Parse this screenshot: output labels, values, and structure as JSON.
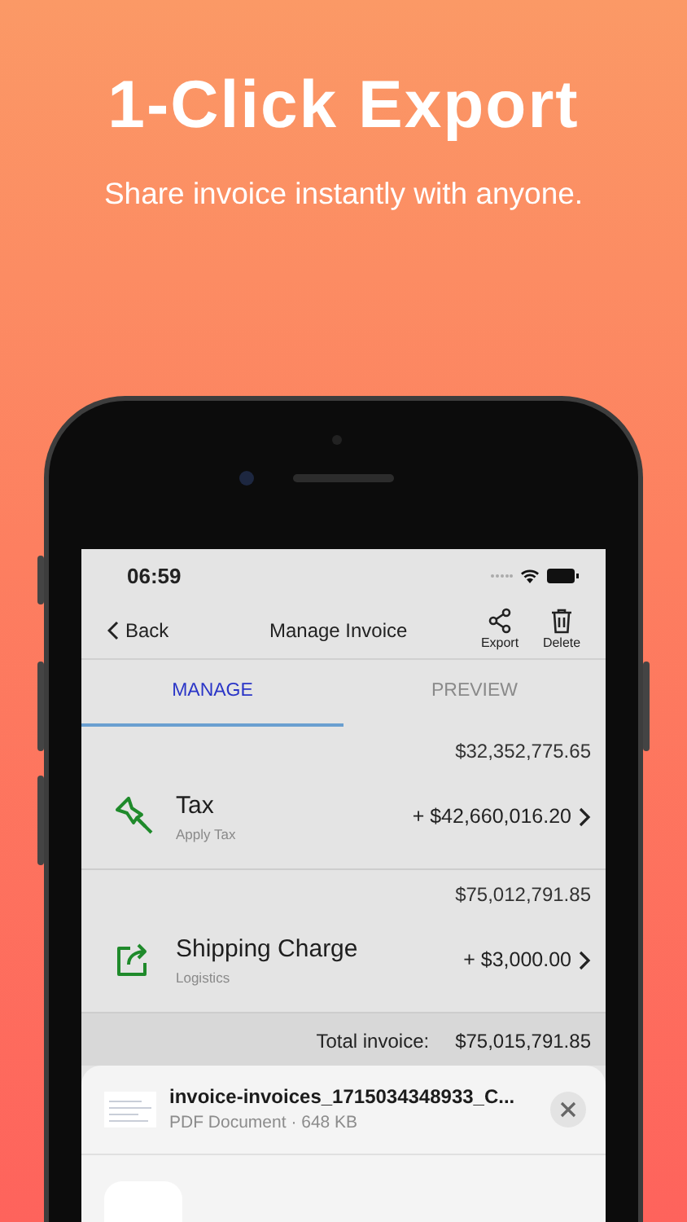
{
  "headline": "1-Click Export",
  "subtitle": "Share invoice instantly with anyone.",
  "status_bar": {
    "time": "06:59"
  },
  "nav": {
    "back": "Back",
    "title": "Manage Invoice",
    "actions": [
      {
        "label": "Export",
        "kind": "share"
      },
      {
        "label": "Delete",
        "kind": "trash"
      }
    ]
  },
  "tabs": [
    {
      "label": "MANAGE",
      "selected": true
    },
    {
      "label": "PREVIEW",
      "selected": false
    }
  ],
  "items": [
    {
      "subtotal": "$32,352,775.65",
      "title": "Tax",
      "subtitle": "Apply Tax",
      "amount": "+ $42,660,016.20",
      "kind": "pin"
    },
    {
      "subtotal": "$75,012,791.85",
      "title": "Shipping Charge",
      "subtitle": "Logistics",
      "amount": "+ $3,000.00",
      "kind": "share"
    }
  ],
  "total": {
    "label": "Total invoice:",
    "value": "$75,015,791.85"
  },
  "share_sheet": {
    "file_name": "invoice-invoices_1715034348933_C...",
    "file_info": "PDF Document · 648 KB",
    "apps": [
      {
        "kind": "more"
      }
    ]
  }
}
